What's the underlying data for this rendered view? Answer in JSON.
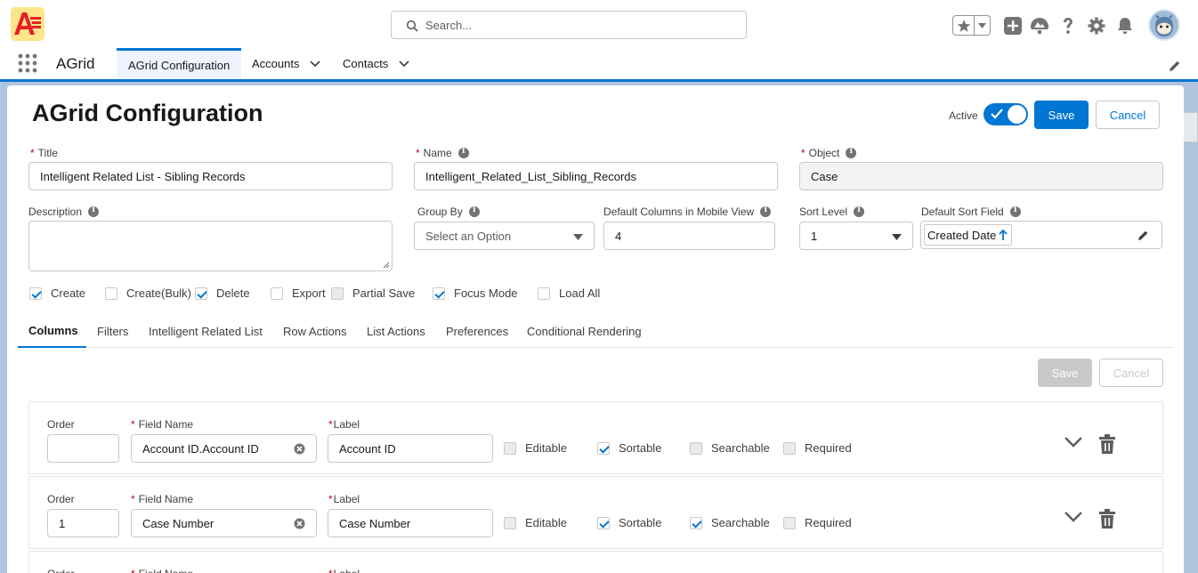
{
  "header": {
    "search_placeholder": "Search...",
    "icons": [
      "favorites-star-icon",
      "add-icon",
      "trailhead-icon",
      "help-icon",
      "setup-gear-icon",
      "notifications-bell-icon",
      "user-avatar"
    ]
  },
  "nav": {
    "app_name": "AGrid",
    "tabs": [
      {
        "label": "AGrid Configuration",
        "active": true
      },
      {
        "label": "Accounts",
        "has_dropdown": true
      },
      {
        "label": "Contacts",
        "has_dropdown": true
      }
    ]
  },
  "page": {
    "title": "AGrid Configuration",
    "active_label": "Active",
    "active_on": true,
    "save_label": "Save",
    "cancel_label": "Cancel"
  },
  "form": {
    "title_label": "Title",
    "title_value": "Intelligent Related List - Sibling Records",
    "name_label": "Name",
    "name_value": "Intelligent_Related_List_Sibling_Records",
    "object_label": "Object",
    "object_value": "Case",
    "description_label": "Description",
    "description_value": "",
    "group_by_label": "Group By",
    "group_by_placeholder": "Select an Option",
    "mobile_cols_label": "Default Columns in Mobile View",
    "mobile_cols_value": "4",
    "sort_level_label": "Sort Level",
    "sort_level_value": "1",
    "sort_field_label": "Default Sort Field",
    "sort_field_value": "Created Date"
  },
  "options": [
    {
      "label": "Create",
      "checked": true
    },
    {
      "label": "Create(Bulk)",
      "checked": false
    },
    {
      "label": "Delete",
      "checked": true
    },
    {
      "label": "Export",
      "checked": false
    },
    {
      "label": "Partial Save",
      "checked": false,
      "disabled": true
    },
    {
      "label": "Focus Mode",
      "checked": true
    },
    {
      "label": "Load All",
      "checked": false
    }
  ],
  "tabs": [
    "Columns",
    "Filters",
    "Intelligent Related List",
    "Row Actions",
    "List Actions",
    "Preferences",
    "Conditional Rendering"
  ],
  "columns_panel": {
    "save_label": "Save",
    "cancel_label": "Cancel",
    "order_label": "Order",
    "field_name_label": "Field Name",
    "label_label": "Label",
    "rows": [
      {
        "order": "",
        "field_name": "Account ID.Account ID",
        "label": "Account ID",
        "editable": false,
        "sortable": true,
        "searchable": false,
        "required": false
      },
      {
        "order": "1",
        "field_name": "Case Number",
        "label": "Case Number",
        "editable": false,
        "sortable": true,
        "searchable": true,
        "required": false
      }
    ],
    "flag_labels": {
      "editable": "Editable",
      "sortable": "Sortable",
      "searchable": "Searchable",
      "required": "Required"
    }
  }
}
